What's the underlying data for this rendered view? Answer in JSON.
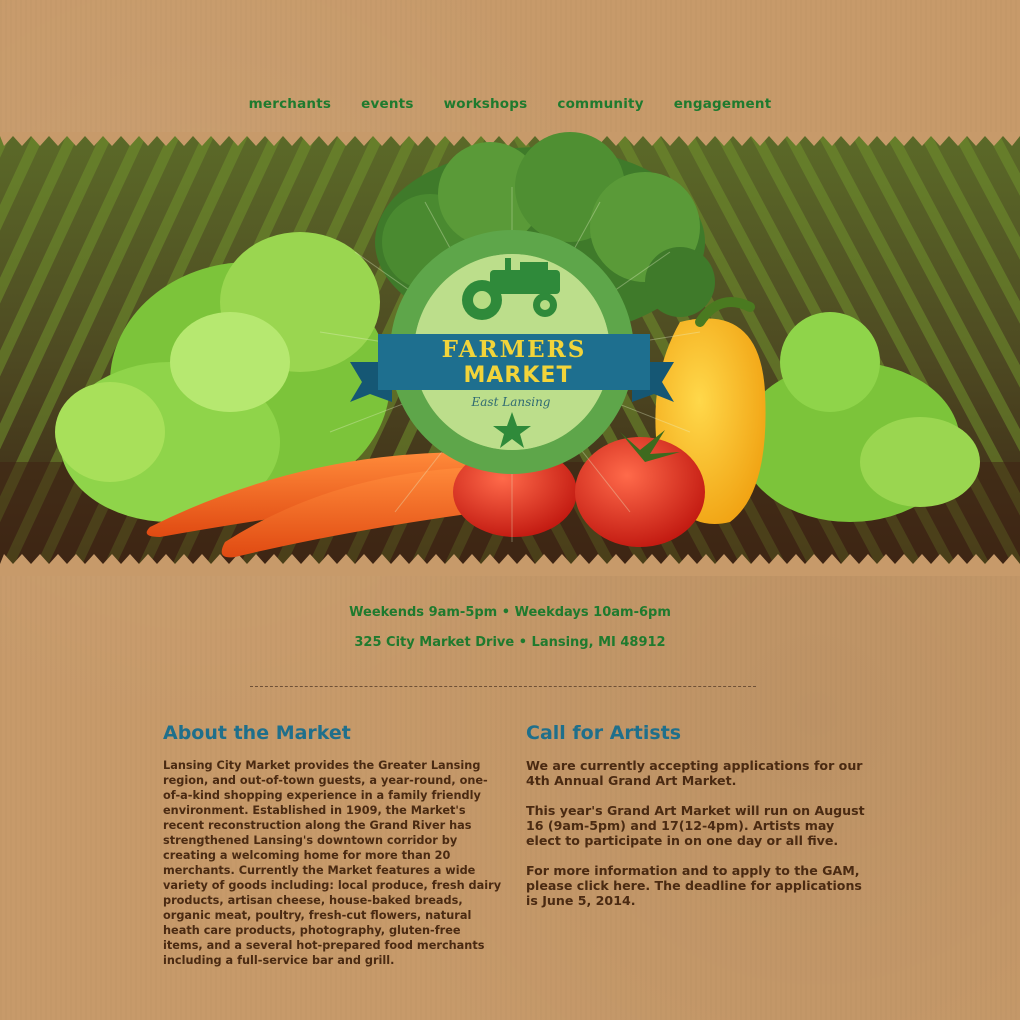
{
  "nav": {
    "items": [
      "merchants",
      "events",
      "workshops",
      "community",
      "engagement"
    ]
  },
  "logo": {
    "line1": "FARMERS",
    "line2": "MARKET",
    "tagline": "East Lansing"
  },
  "info": {
    "hours": "Weekends 9am-5pm • Weekdays 10am-6pm",
    "address": "325 City Market Drive • Lansing, MI 48912"
  },
  "about": {
    "heading": "About the Market",
    "body": "Lansing City Market provides the Greater Lansing region, and out-of-town guests, a year-round, one-of-a-kind shopping experience in a family friendly environment. Established in 1909, the Market's recent reconstruction along the Grand River has strengthened Lansing's downtown corridor by creating a welcoming home for more than 20 merchants. Currently the Market features a wide variety of goods including: local produce, fresh dairy products, artisan cheese, house-baked breads, organic meat, poultry, fresh-cut flowers, natural heath care products, photography, gluten-free items, and a several hot-prepared food merchants including a full-service bar and grill."
  },
  "artists": {
    "heading": "Call for Artists",
    "para1": "We are currently accepting applications for our 4th Annual Grand Art Market.",
    "para2": "This year's Grand Art Market will run on August 16 (9am-5pm) and 17(12-4pm). Artists may elect to participate in on one day or all five.",
    "para3": "For more information and to apply to the GAM, please click here. The deadline for applications is June 5, 2014."
  },
  "colors": {
    "background": "#c79a6a",
    "nav_green": "#1f7a2e",
    "heading_blue": "#1f6f8b",
    "body_brown": "#4a2a12",
    "badge_green": "#5ea64a",
    "ribbon_blue": "#1e6f8f",
    "logo_yellow": "#f2d43a"
  },
  "icons": [
    "tractor-icon",
    "star-icon"
  ]
}
